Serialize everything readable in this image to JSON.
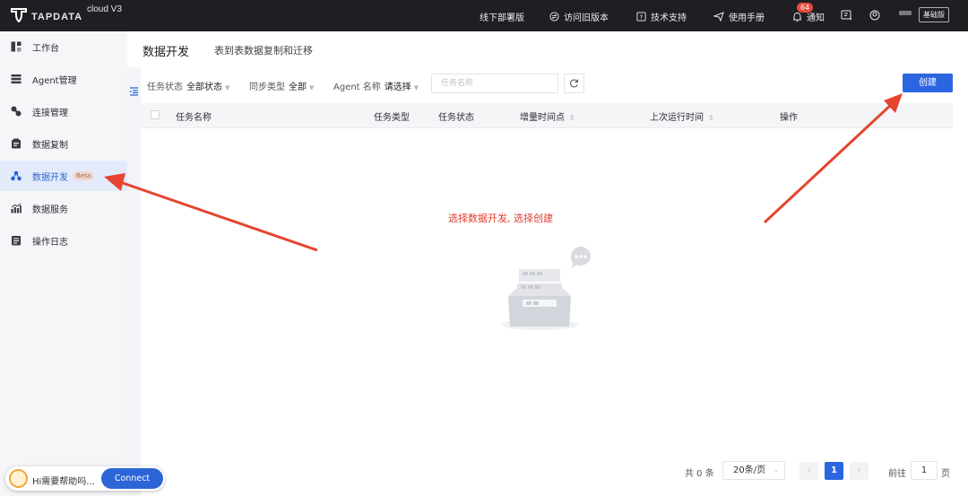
{
  "topbar": {
    "brand": "TAPDATA",
    "brand_sub": "cloud V3",
    "offline_deploy": "线下部署版",
    "old_version": "访问旧版本",
    "support": "技术支持",
    "manual": "使用手册",
    "notify_count": "64",
    "notify": "通知",
    "plan": "基础版"
  },
  "sidebar": {
    "items": [
      {
        "label": "工作台",
        "icon": "dashboard-icon"
      },
      {
        "label": "Agent管理",
        "icon": "agent-icon"
      },
      {
        "label": "连接管理",
        "icon": "connection-icon"
      },
      {
        "label": "数据复制",
        "icon": "replication-icon"
      },
      {
        "label": "数据开发",
        "icon": "dev-icon",
        "badge": "Beta",
        "active": true
      },
      {
        "label": "数据服务",
        "icon": "service-icon"
      },
      {
        "label": "操作日志",
        "icon": "log-icon"
      }
    ]
  },
  "page": {
    "title": "数据开发",
    "subtitle": "表到表数据复制和迁移"
  },
  "filters": {
    "status_label": "任务状态",
    "status_value": "全部状态",
    "sync_label": "同步类型",
    "sync_value": "全部",
    "agent_label": "Agent 名称",
    "agent_value": "请选择",
    "search_placeholder": "任务名称"
  },
  "create_label": "创建",
  "table": {
    "columns": [
      "任务名称",
      "任务类型",
      "任务状态",
      "增量时间点",
      "上次运行时间",
      "操作"
    ]
  },
  "annotation": "选择数据开发, 选择创建",
  "pagination": {
    "total": "共 0 条",
    "page_size": "20条/页",
    "current": "1",
    "goto_label": "前往",
    "goto_value": "1",
    "goto_suffix": "页"
  },
  "help": {
    "text": "Hi需要帮助吗...",
    "connect": "Connect"
  },
  "colors": {
    "accent": "#2c65e0",
    "arrow": "#e5452e",
    "topbar": "#1f1f23"
  }
}
